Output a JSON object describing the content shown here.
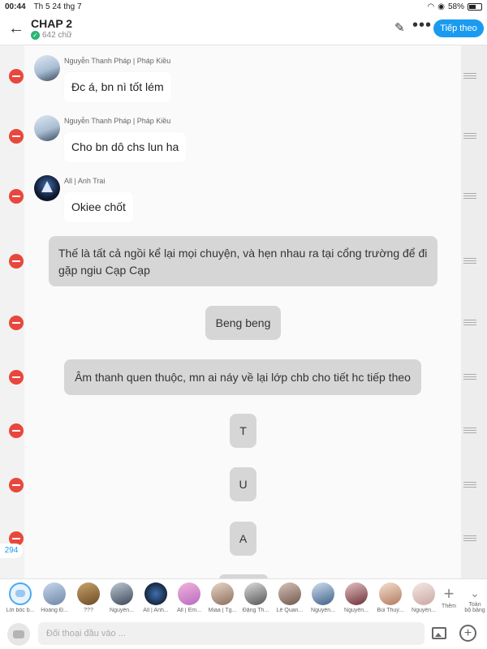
{
  "status_bar": {
    "time": "00:44",
    "date": "Th 5 24 thg 7",
    "battery": "58%",
    "battery_level": 0.58
  },
  "header": {
    "title": "CHAP 2",
    "subtitle": "642 chữ",
    "next_button": "Tiếp theo"
  },
  "messages": [
    {
      "sender": "Nguyễn Thanh Pháp | Pháp Kiều",
      "text": "Đc á, bn nì tốt lém"
    },
    {
      "sender": "Nguyễn Thanh Pháp | Pháp Kiều",
      "text": "Cho bn dô chs lun ha"
    },
    {
      "sender": "All | Anh Trai",
      "text": "Okiee chốt"
    },
    {
      "text": "Thế là tất cả ngồi kể lại mọi chuyện, và hẹn nhau ra tại cổng trường để đi gặp ngiu Cạp Cạp"
    },
    {
      "text": "Beng beng"
    },
    {
      "text": "Âm thanh quen thuộc, mn ai náy về lại lớp chb cho tiết hc tiếp theo"
    },
    {
      "text": "T"
    },
    {
      "text": "U"
    },
    {
      "text": "A"
    }
  ],
  "count_badge": "294",
  "characters": [
    "Lời bốc b...",
    "Hoàng Đ...",
    "???",
    "Nguyễn...",
    "All | Anh...",
    "All | Em...",
    "Miaa | Tg...",
    "Đặng Th...",
    "Lê Quan...",
    "Nguyễn...",
    "Nguyễn...",
    "Bùi Thuỳ...",
    "Nguyễn..."
  ],
  "character_bar": {
    "add_label": "Thêm",
    "fullscreen_label_1": "Toàn",
    "fullscreen_label_2": "bộ bảng"
  },
  "input": {
    "placeholder": "Đối thoại đầu vào ..."
  }
}
